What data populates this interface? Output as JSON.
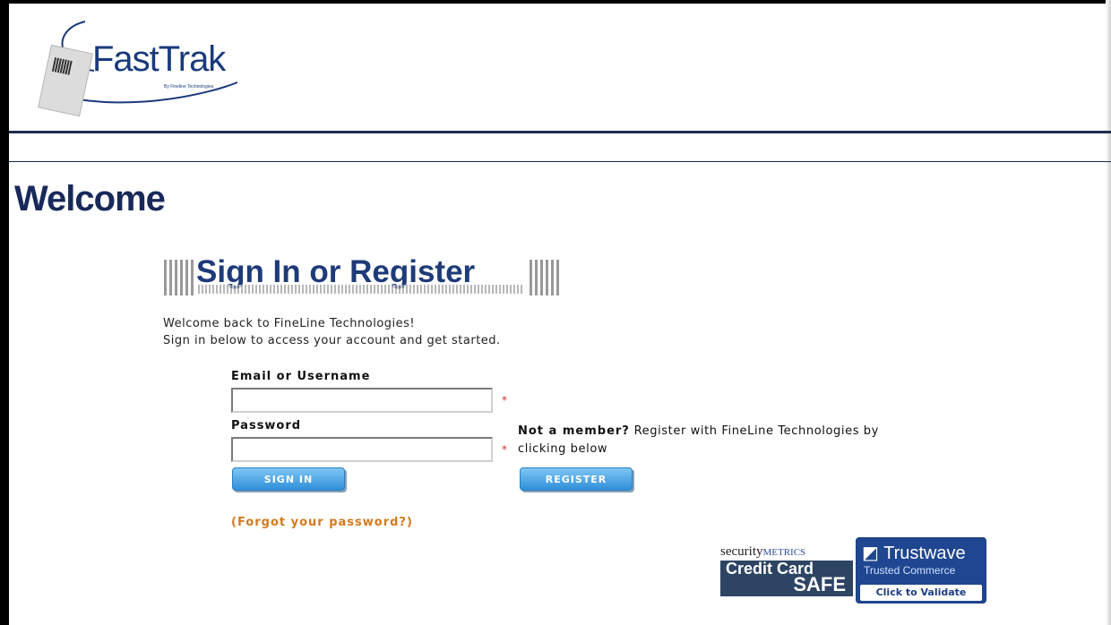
{
  "logo": {
    "name": "FastTrak",
    "subtitle": "By Fineline Technologies"
  },
  "page": {
    "welcome": "Welcome",
    "section_title": "Sign In or Register"
  },
  "intro": {
    "line1": "Welcome back to FineLine Technologies!",
    "line2": "Sign in below to access your account and get started."
  },
  "form": {
    "email_label": "Email or Username",
    "password_label": "Password",
    "required_mark": "*",
    "sign_in_label": "SIGN IN",
    "forgot_label": "(Forgot your password?)"
  },
  "register": {
    "prompt_bold": "Not a member?",
    "prompt_text": "Register with FineLine Technologies by",
    "prompt_text2": "clicking below",
    "button_label": "REGISTER"
  },
  "badges": {
    "securitymetrics_top": "security",
    "securitymetrics_top2": "METRICS",
    "securitymetrics_line1": "Credit Card",
    "securitymetrics_line2": "SAFE",
    "trustwave_title": "Trustwave",
    "trustwave_sub": "Trusted Commerce",
    "trustwave_cta": "Click to Validate"
  },
  "colors": {
    "brand": "#1e3a78",
    "link_orange": "#d47a1e",
    "button_blue": "#2f8fd8",
    "required_red": "#d03030"
  }
}
